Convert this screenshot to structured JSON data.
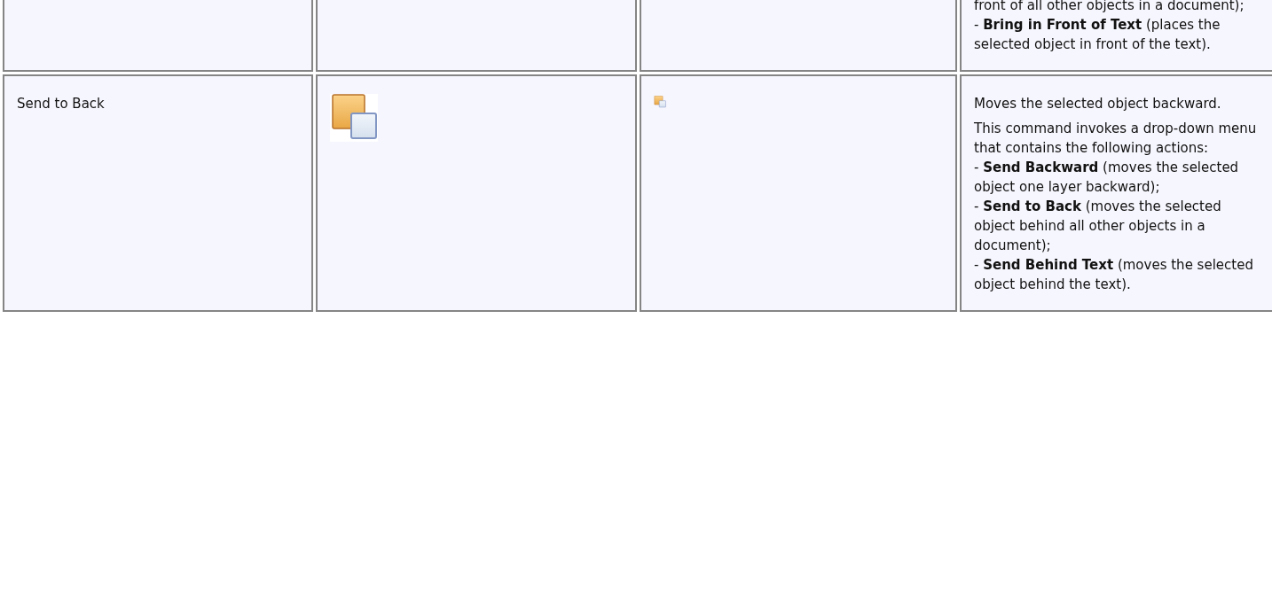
{
  "table": {
    "rows": [
      {
        "cells": [
          {
            "kind": "empty"
          },
          {
            "kind": "empty"
          },
          {
            "kind": "empty"
          },
          {
            "kind": "description",
            "paragraphs": [
              [
                "front of all other objects in a document);",
                "- **Bring in Front of Text** (places the selected object in front of the text)."
              ]
            ]
          }
        ]
      },
      {
        "cells": [
          {
            "kind": "text",
            "text": "Send to Back"
          },
          {
            "kind": "large-icon"
          },
          {
            "kind": "small-icon"
          },
          {
            "kind": "description",
            "paragraphs": [
              [
                "Moves the selected object backward."
              ],
              [
                "This command invokes a drop-down menu that contains the following actions:",
                "- **Send Backward** (moves the selected object one layer backward);",
                "- **Send to Back** (moves the selected object behind all other objects in a document);",
                "- **Send Behind Text** (moves the selected object behind the text)."
              ]
            ]
          }
        ]
      }
    ]
  }
}
